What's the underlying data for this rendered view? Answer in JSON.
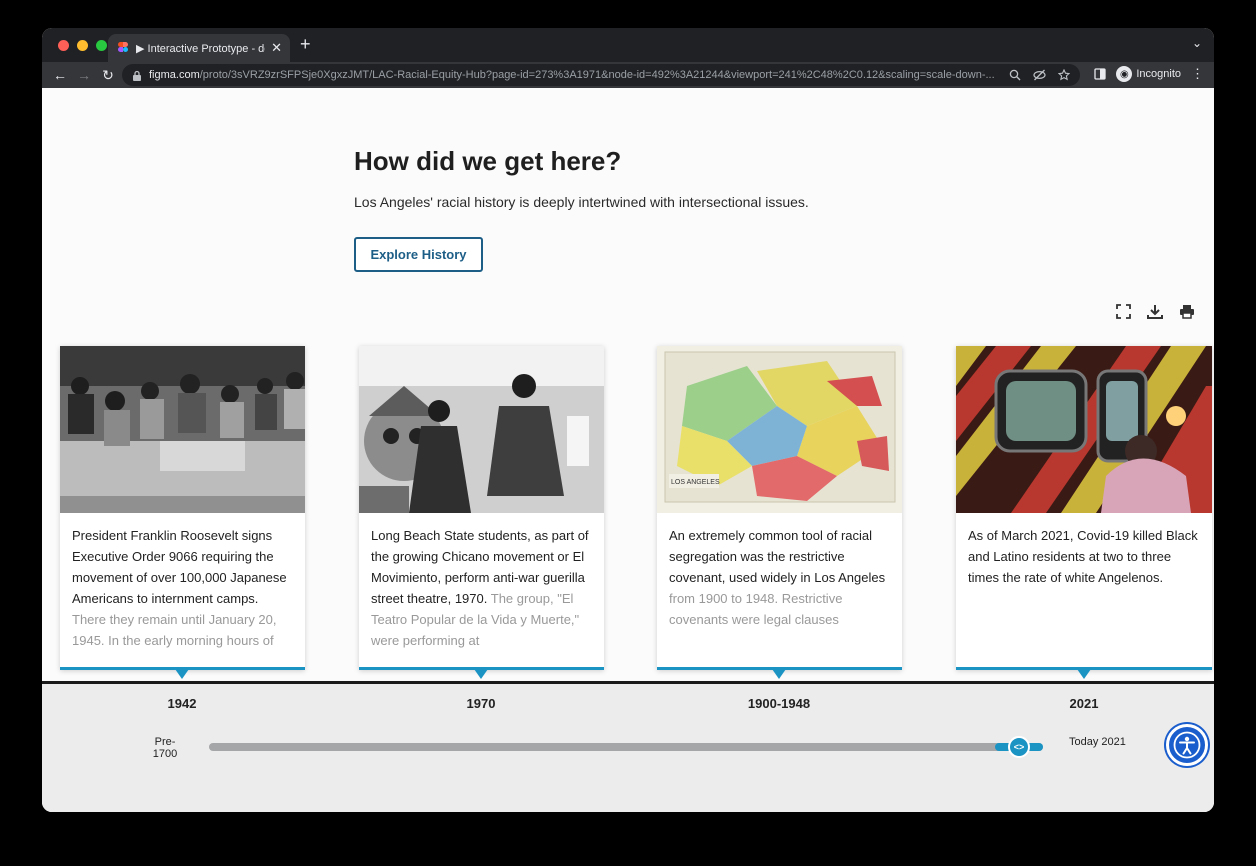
{
  "browser": {
    "tab_title": "▶ Interactive Prototype - desk",
    "tab_close": "✕",
    "new_tab": "+",
    "tab_menu": "⌄",
    "url_host": "figma.com",
    "url_rest": "/proto/3sVRZ9zrSFPSje0XgxzJMT/LAC-Racial-Equity-Hub?page-id=273%3A1971&node-id=492%3A21244&viewport=241%2C48%2C0.12&scaling=scale-down-...",
    "incognito_label": "Incognito",
    "back": "←",
    "forward": "→",
    "reload": "↻"
  },
  "page": {
    "heading": "How did we get here?",
    "intro": "Los Angeles' racial history is deeply intertwined with intersectional issues.",
    "explore_button": "Explore History"
  },
  "timeline": {
    "cards": [
      {
        "text": "President Franklin Roosevelt signs Executive Order 9066 requiring the movement of over 100,000 Japanese Americans to internment camps.",
        "fade_text": "There they remain until January 20, 1945. In the early morning hours of",
        "year": "1942"
      },
      {
        "text": "Long Beach State students, as part of the growing Chicano movement or El Movimiento, perform anti-war guerilla street theatre, 1970.",
        "fade_text": "The group, \"El Teatro Popular de la Vida y Muerte,\" were performing at",
        "year": "1970"
      },
      {
        "text": "An extremely common tool of racial segregation was the restrictive covenant, used widely in Los Angeles",
        "fade_text": "from 1900 to 1948. Restrictive covenants were legal clauses",
        "year": "1900-1948"
      },
      {
        "text": "As of March 2021, Covid-19 killed Black and Latino residents at two to three times the rate of white Angelenos.",
        "fade_text": "",
        "year": "2021"
      }
    ],
    "range_start": "Pre-1700",
    "range_end": "Today 2021",
    "slider_position": 0.96,
    "handle_glyph": "<>"
  },
  "colors": {
    "accent": "#1b94c4",
    "button_border": "#1d5e87",
    "a11y_blue": "#1a5dcc"
  },
  "icons": [
    "fullscreen-icon",
    "download-icon",
    "print-icon",
    "accessibility-icon",
    "lock-icon",
    "zoom-icon",
    "eye-off-icon",
    "star-icon",
    "sidepanel-icon",
    "menu-icon"
  ]
}
